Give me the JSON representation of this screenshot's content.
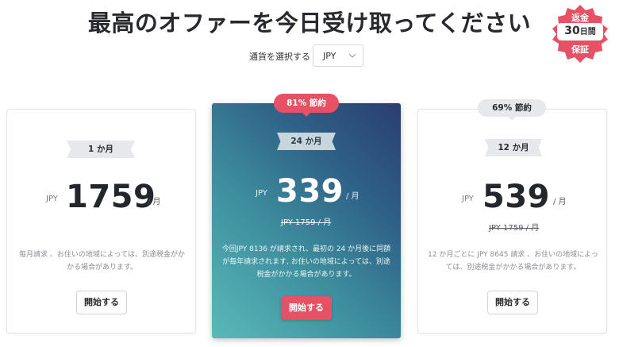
{
  "title": "最高のオファーを今日受け取ってください",
  "guarantee_badge": {
    "line1": "返金",
    "line2_number": "30",
    "line2_unit": "日間",
    "line3": "保証",
    "color": "#e65164"
  },
  "currency": {
    "label": "通貨を選択する",
    "selected": "JPY",
    "icon": "chevron-down-icon"
  },
  "plans": [
    {
      "term": "1 か月",
      "currency": "JPY",
      "price": "1759",
      "per": "/ 月",
      "description": "毎月請求 、お住いの地域によっては、別途税金がかかる場合があります。",
      "button": "開始する"
    },
    {
      "saving": "81% 節約",
      "term": "24 か月",
      "currency": "JPY",
      "price": "339",
      "per": "/ 月",
      "original_price": "JPY 1759 / 月",
      "description": "今回JPY 8136 が請求され、最初の 24 か月後に同額が毎年請求されます, お住いの地域によっては、別途税金がかかる場合があります。",
      "button": "開始する",
      "featured": true
    },
    {
      "saving": "69% 節約",
      "term": "12 か月",
      "currency": "JPY",
      "price": "539",
      "per": "/ 月",
      "original_price": "JPY 1759 / 月",
      "description": "12 か月ごとに JPY 8645 請求 、お住いの地域によっては、別途税金がかかる場合があります。",
      "button": "開始する"
    }
  ],
  "colors": {
    "accent_red": "#e65164",
    "featured_gradient_start": "#5ab9b9",
    "featured_gradient_end": "#293d70"
  }
}
